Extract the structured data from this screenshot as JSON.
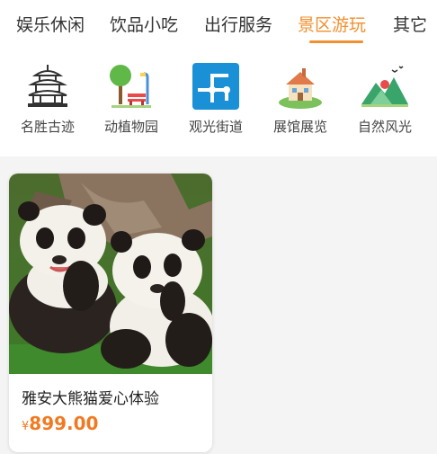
{
  "colors": {
    "accent": "#f0902f",
    "price": "#f07a22",
    "text": "#333333",
    "background": "#f4f4f4"
  },
  "nav": {
    "tabs": [
      {
        "label": "娱乐休闲",
        "active": false
      },
      {
        "label": "饮品小吃",
        "active": false
      },
      {
        "label": "出行服务",
        "active": false
      },
      {
        "label": "景区游玩",
        "active": true
      },
      {
        "label": "其它",
        "active": false
      }
    ]
  },
  "categories": [
    {
      "label": "名胜古迹",
      "icon": "temple-icon"
    },
    {
      "label": "动植物园",
      "icon": "park-icon"
    },
    {
      "label": "观光街道",
      "icon": "street-map-icon"
    },
    {
      "label": "展馆展览",
      "icon": "museum-icon"
    },
    {
      "label": "自然风光",
      "icon": "mountain-icon"
    }
  ],
  "products": [
    {
      "title": "雅安大熊猫爱心体验",
      "currency": "¥",
      "price": "899.00",
      "image": "panda-photo"
    }
  ]
}
